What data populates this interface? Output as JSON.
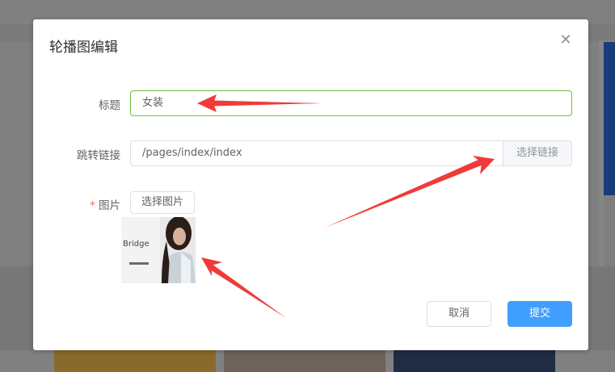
{
  "dialog": {
    "title": "轮播图编辑",
    "close_icon": "close-icon"
  },
  "form": {
    "title_label": "标题",
    "title_value": "女装",
    "link_label": "跳转链接",
    "link_value": "/pages/index/index",
    "link_button": "选择链接",
    "image_label": "图片",
    "required_mark": "*",
    "image_button": "选择图片",
    "thumbnail_text": "Bridge"
  },
  "footer": {
    "cancel": "取消",
    "submit": "提交"
  },
  "colors": {
    "primary": "#409eff",
    "valid_border": "#67c23a",
    "required": "#f56c6c",
    "annotation_arrow": "#f03a3a"
  }
}
